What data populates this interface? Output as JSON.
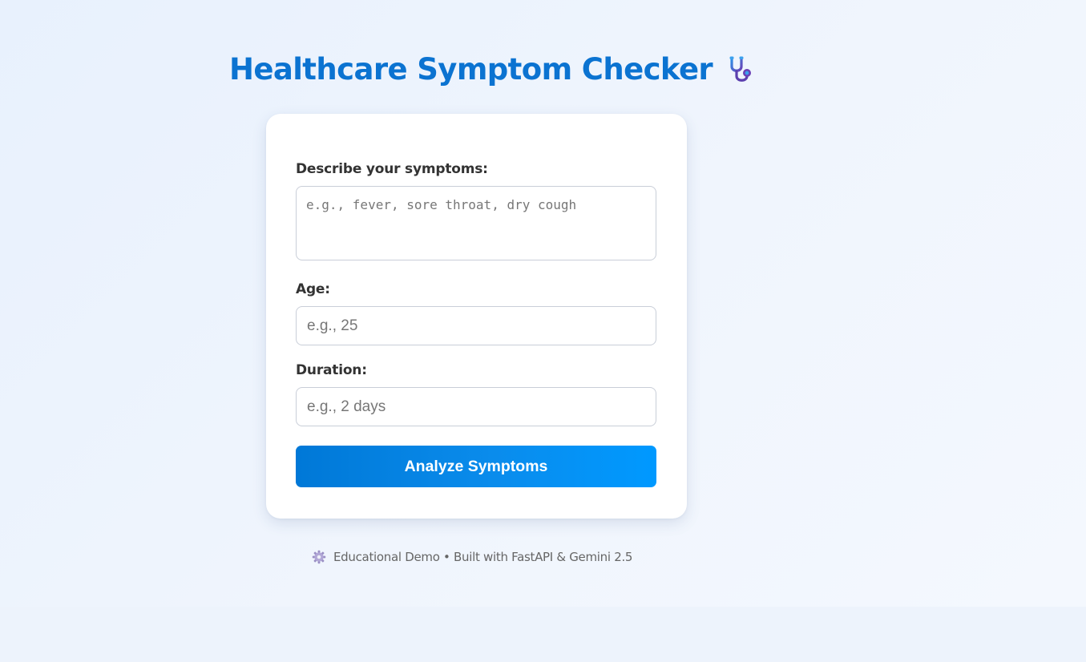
{
  "header": {
    "title": "Healthcare Symptom Checker",
    "title_icon": "stethoscope-icon"
  },
  "form": {
    "symptoms": {
      "label": "Describe your symptoms:",
      "value": "",
      "placeholder": "e.g., fever, sore throat, dry cough"
    },
    "age": {
      "label": "Age:",
      "value": "",
      "placeholder": "e.g., 25"
    },
    "duration": {
      "label": "Duration:",
      "value": "",
      "placeholder": "e.g., 2 days"
    },
    "submit_label": "Analyze Symptoms"
  },
  "footer": {
    "icon": "gear-icon",
    "text": "Educational Demo • Built with FastAPI & Gemini 2.5"
  },
  "colors": {
    "title": "#0b73d1",
    "button_start": "#0078d7",
    "button_end": "#0099ff",
    "background": "#edf3fc"
  }
}
